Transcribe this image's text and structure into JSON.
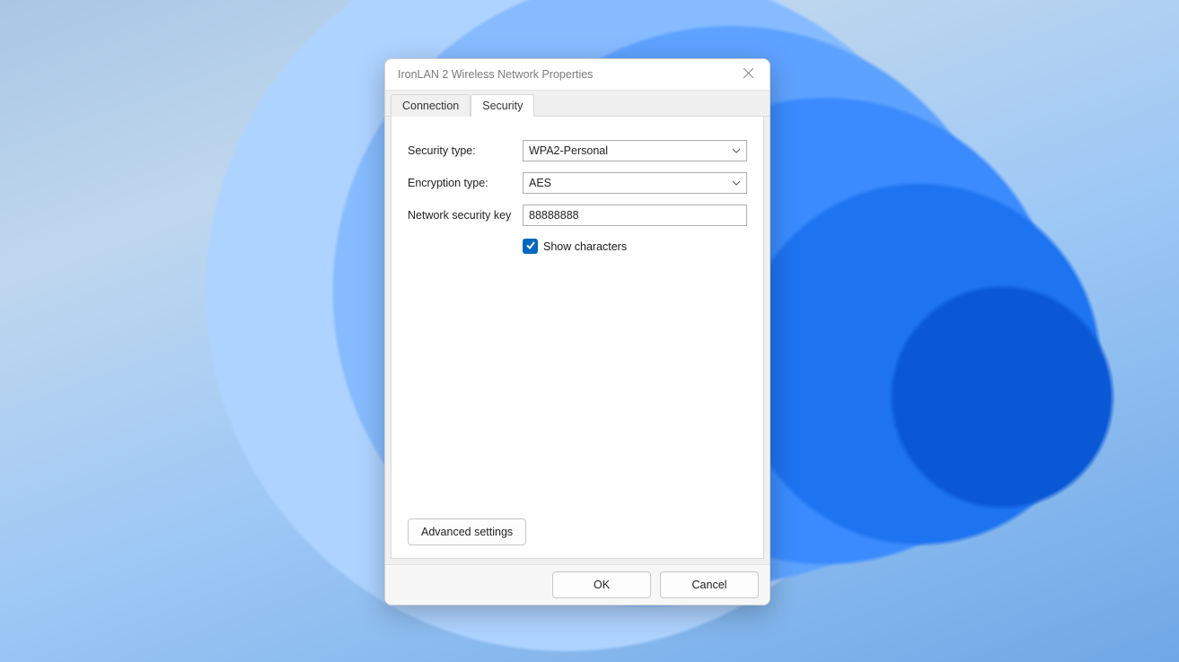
{
  "window": {
    "title": "IronLAN 2 Wireless Network Properties"
  },
  "tabs": {
    "connection": "Connection",
    "security": "Security",
    "active": "security"
  },
  "form": {
    "security_type_label": "Security type:",
    "security_type_value": "WPA2-Personal",
    "encryption_type_label": "Encryption type:",
    "encryption_type_value": "AES",
    "network_key_label": "Network security key",
    "network_key_value": "88888888",
    "show_characters_label": "Show characters",
    "show_characters_checked": true,
    "advanced_button": "Advanced settings"
  },
  "footer": {
    "ok": "OK",
    "cancel": "Cancel"
  }
}
